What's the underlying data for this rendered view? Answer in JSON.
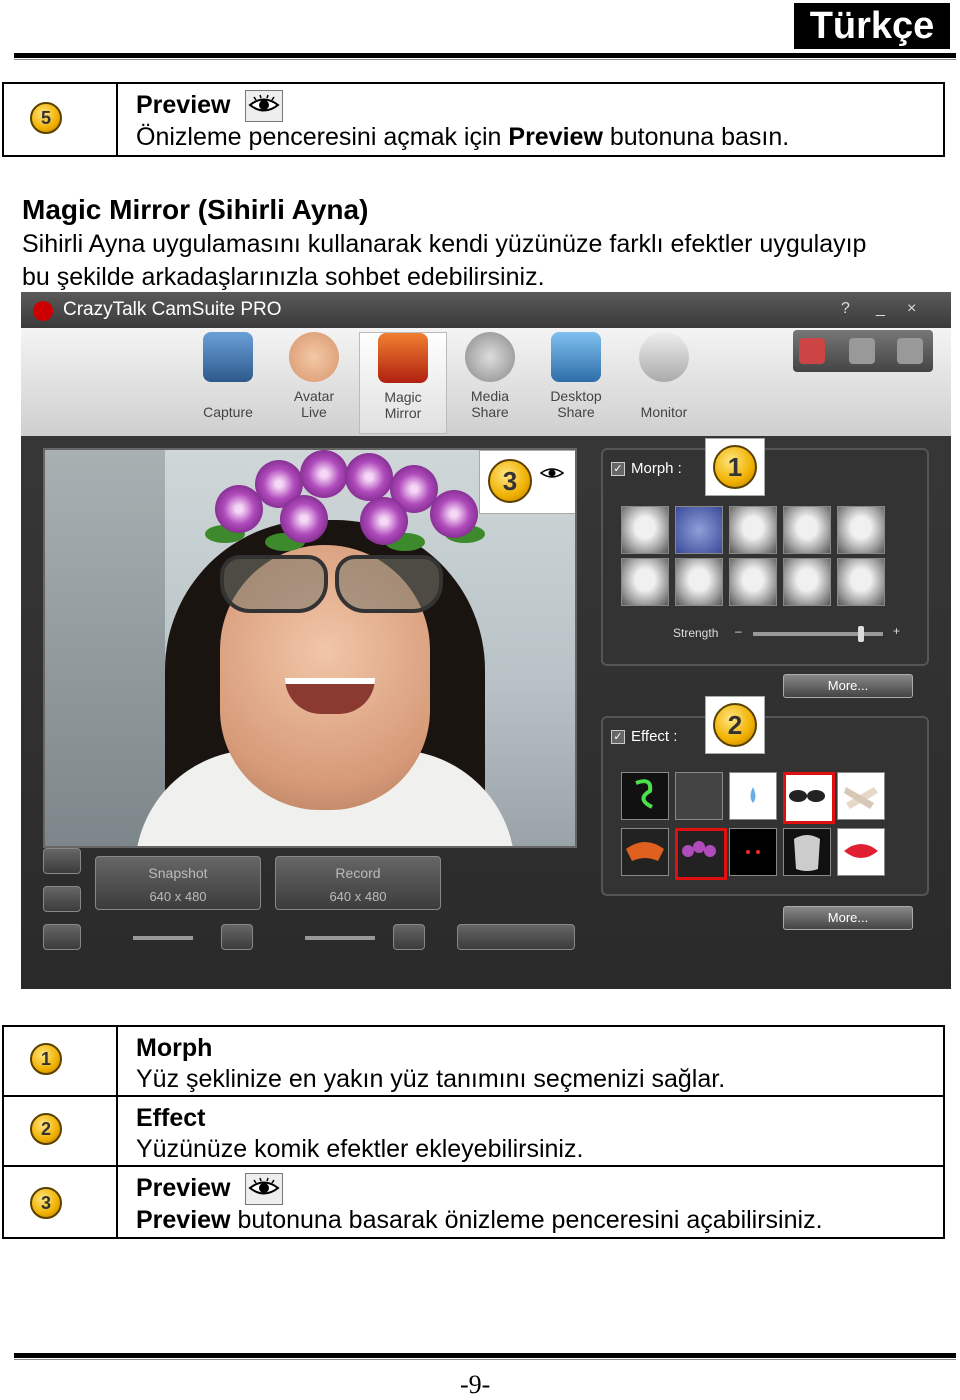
{
  "header": {
    "language": "Türkçe"
  },
  "top_item": {
    "number": "5",
    "title": "Preview",
    "desc_pre": "Önizleme penceresini açmak için ",
    "desc_bold": "Preview",
    "desc_post": " butonuna basın."
  },
  "section": {
    "heading": "Magic Mirror (Sihirli Ayna)",
    "line1": "Sihirli Ayna uygulamasını kullanarak kendi yüzünüze farklı efektler uygulayıp",
    "line2": "bu şekilde arkadaşlarınızla sohbet edebilirsiniz."
  },
  "app": {
    "title": "CrazyTalk CamSuite PRO",
    "win_help": "?",
    "win_min": "_",
    "win_close": "×",
    "tabs": [
      {
        "l1": "",
        "l2": "Capture"
      },
      {
        "l1": "Avatar",
        "l2": "Live"
      },
      {
        "l1": "Magic",
        "l2": "Mirror"
      },
      {
        "l1": "Media",
        "l2": "Share"
      },
      {
        "l1": "Desktop",
        "l2": "Share"
      },
      {
        "l1": "",
        "l2": "Monitor"
      }
    ],
    "morph_label": "Morph :",
    "effect_label": "Effect :",
    "strength_label": "Strength",
    "strength_minus": "–",
    "strength_plus": "+",
    "strength_value": 0.85,
    "more_label": "More...",
    "snapshot_label": "Snapshot",
    "record_label": "Record",
    "resolution": "640 x 480",
    "callouts": [
      "1",
      "2",
      "3"
    ]
  },
  "items": [
    {
      "number": "1",
      "title": "Morph",
      "desc": "Yüz şeklinize en yakın yüz tanımını seçmenizi sağlar."
    },
    {
      "number": "2",
      "title": "Effect",
      "desc": "Yüzünüze komik efektler ekleyebilirsiniz."
    },
    {
      "number": "3",
      "title": "Preview",
      "desc_bold": "Preview",
      "desc_post": " butonuna basarak önizleme penceresini açabilirsiniz."
    }
  ],
  "footer": {
    "page": "-9-"
  }
}
